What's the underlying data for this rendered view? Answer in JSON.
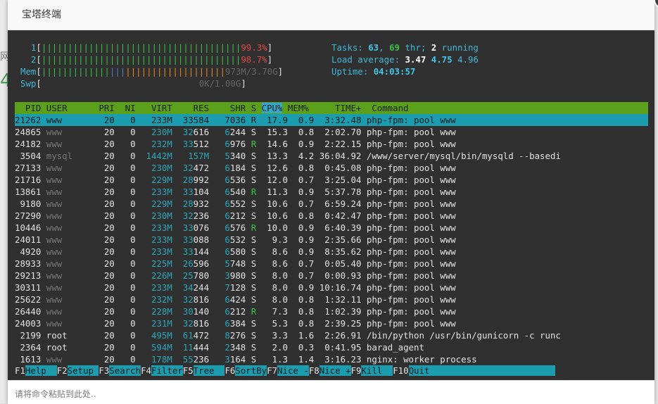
{
  "dialog": {
    "title": "宝塔终端",
    "input_placeholder": "请将命令粘贴到此处..",
    "backdrop_glyphs": [
      "网",
      "4"
    ]
  },
  "htop": {
    "meters": [
      {
        "label": "1",
        "bar": "||||||||||||||||||||||||||||||||||||||",
        "value": "99.3%"
      },
      {
        "label": "2",
        "bar": "||||||||||||||||||||||||||||||||||||||",
        "value": "98.7%"
      },
      {
        "label": "Mem",
        "bar_green": "|||||||||||||",
        "bar_blue": "|||",
        "bar_orange": "|||||||||||||||||||",
        "value": "973M/3.70G"
      },
      {
        "label": "Swp",
        "bar": "",
        "value": "0K/1.00G"
      }
    ],
    "tasks_label": "Tasks:",
    "tasks": "63",
    "thr": "69",
    "thr_label": "thr;",
    "running": "2",
    "running_label": "running",
    "load_label": "Load average:",
    "load1": "3.47",
    "load5": "4.75",
    "load15": "4.96",
    "uptime_label": "Uptime:",
    "uptime": "04:03:57",
    "columns": [
      "PID",
      "USER",
      "PRI",
      "NI",
      "VIRT",
      "RES",
      "SHR",
      "S",
      "CPU%",
      "MEM%",
      "TIME+",
      "Command"
    ],
    "processes": [
      {
        "pid": "21262",
        "user": "www",
        "pri": "20",
        "ni": "0",
        "virt": "233M",
        "res": "33584",
        "shr": "7036",
        "s": "R",
        "cpu": "17.9",
        "mem": "0.9",
        "time": "3:32.48",
        "cmd": "php-fpm: pool www"
      },
      {
        "pid": "24865",
        "user": "www",
        "pri": "20",
        "ni": "0",
        "virt": "230M",
        "res": "32616",
        "shr": "6244",
        "s": "S",
        "cpu": "15.3",
        "mem": "0.8",
        "time": "2:02.70",
        "cmd": "php-fpm: pool www"
      },
      {
        "pid": "24182",
        "user": "www",
        "pri": "20",
        "ni": "0",
        "virt": "232M",
        "res": "33512",
        "shr": "6976",
        "s": "R",
        "cpu": "14.6",
        "mem": "0.9",
        "time": "2:22.15",
        "cmd": "php-fpm: pool www"
      },
      {
        "pid": "3504",
        "user": "mysql",
        "pri": "20",
        "ni": "0",
        "virt": "1442M",
        "res": "157M",
        "shr": "5340",
        "s": "S",
        "cpu": "13.3",
        "mem": "4.2",
        "time": "36:04.92",
        "cmd": "/www/server/mysql/bin/mysqld --basedi"
      },
      {
        "pid": "27133",
        "user": "www",
        "pri": "20",
        "ni": "0",
        "virt": "230M",
        "res": "32472",
        "shr": "6184",
        "s": "S",
        "cpu": "12.6",
        "mem": "0.8",
        "time": "0:45.08",
        "cmd": "php-fpm: pool www"
      },
      {
        "pid": "21716",
        "user": "www",
        "pri": "20",
        "ni": "0",
        "virt": "229M",
        "res": "28992",
        "shr": "6536",
        "s": "S",
        "cpu": "12.0",
        "mem": "0.7",
        "time": "3:25.04",
        "cmd": "php-fpm: pool www"
      },
      {
        "pid": "13861",
        "user": "www",
        "pri": "20",
        "ni": "0",
        "virt": "233M",
        "res": "33104",
        "shr": "6540",
        "s": "R",
        "cpu": "11.3",
        "mem": "0.9",
        "time": "5:37.78",
        "cmd": "php-fpm: pool www"
      },
      {
        "pid": "9180",
        "user": "www",
        "pri": "20",
        "ni": "0",
        "virt": "229M",
        "res": "28932",
        "shr": "6552",
        "s": "S",
        "cpu": "10.6",
        "mem": "0.7",
        "time": "6:59.24",
        "cmd": "php-fpm: pool www"
      },
      {
        "pid": "27290",
        "user": "www",
        "pri": "20",
        "ni": "0",
        "virt": "230M",
        "res": "32236",
        "shr": "6212",
        "s": "S",
        "cpu": "10.6",
        "mem": "0.8",
        "time": "0:42.47",
        "cmd": "php-fpm: pool www"
      },
      {
        "pid": "10446",
        "user": "www",
        "pri": "20",
        "ni": "0",
        "virt": "233M",
        "res": "33076",
        "shr": "6576",
        "s": "R",
        "cpu": "10.0",
        "mem": "0.9",
        "time": "6:40.39",
        "cmd": "php-fpm: pool www"
      },
      {
        "pid": "24011",
        "user": "www",
        "pri": "20",
        "ni": "0",
        "virt": "233M",
        "res": "33088",
        "shr": "6532",
        "s": "S",
        "cpu": "9.3",
        "mem": "0.9",
        "time": "2:35.66",
        "cmd": "php-fpm: pool www"
      },
      {
        "pid": "4920",
        "user": "www",
        "pri": "20",
        "ni": "0",
        "virt": "233M",
        "res": "33144",
        "shr": "6580",
        "s": "S",
        "cpu": "8.6",
        "mem": "0.9",
        "time": "8:35.62",
        "cmd": "php-fpm: pool www"
      },
      {
        "pid": "28933",
        "user": "www",
        "pri": "20",
        "ni": "0",
        "virt": "225M",
        "res": "26596",
        "shr": "5748",
        "s": "S",
        "cpu": "8.6",
        "mem": "0.7",
        "time": "0:05.40",
        "cmd": "php-fpm: pool www"
      },
      {
        "pid": "29213",
        "user": "www",
        "pri": "20",
        "ni": "0",
        "virt": "226M",
        "res": "25780",
        "shr": "3980",
        "s": "S",
        "cpu": "8.0",
        "mem": "0.7",
        "time": "0:00.93",
        "cmd": "php-fpm: pool www"
      },
      {
        "pid": "30311",
        "user": "www",
        "pri": "20",
        "ni": "0",
        "virt": "233M",
        "res": "34244",
        "shr": "7128",
        "s": "S",
        "cpu": "8.0",
        "mem": "0.9",
        "time": "10:16.74",
        "cmd": "php-fpm: pool www"
      },
      {
        "pid": "25622",
        "user": "www",
        "pri": "20",
        "ni": "0",
        "virt": "232M",
        "res": "32816",
        "shr": "6424",
        "s": "S",
        "cpu": "8.0",
        "mem": "0.8",
        "time": "1:32.11",
        "cmd": "php-fpm: pool www"
      },
      {
        "pid": "26440",
        "user": "www",
        "pri": "20",
        "ni": "0",
        "virt": "228M",
        "res": "30140",
        "shr": "6212",
        "s": "R",
        "cpu": "7.3",
        "mem": "0.8",
        "time": "1:02.39",
        "cmd": "php-fpm: pool www"
      },
      {
        "pid": "24003",
        "user": "www",
        "pri": "20",
        "ni": "0",
        "virt": "231M",
        "res": "32816",
        "shr": "6384",
        "s": "S",
        "cpu": "5.3",
        "mem": "0.8",
        "time": "2:39.25",
        "cmd": "php-fpm: pool www"
      },
      {
        "pid": "2199",
        "user": "root",
        "pri": "20",
        "ni": "0",
        "virt": "495M",
        "res": "61472",
        "shr": "8276",
        "s": "S",
        "cpu": "3.3",
        "mem": "1.6",
        "time": "2:26.91",
        "cmd": "/bin/python /usr/bin/gunicorn -c runc"
      },
      {
        "pid": "2364",
        "user": "root",
        "pri": "20",
        "ni": "0",
        "virt": "594M",
        "res": "11444",
        "shr": "2348",
        "s": "S",
        "cpu": "2.0",
        "mem": "0.3",
        "time": "0:41.95",
        "cmd": "barad_agent"
      },
      {
        "pid": "1613",
        "user": "www",
        "pri": "20",
        "ni": "0",
        "virt": "178M",
        "res": "55236",
        "shr": "3164",
        "s": "S",
        "cpu": "1.3",
        "mem": "1.4",
        "time": "3:16.23",
        "cmd": "nginx: worker process"
      }
    ],
    "fkeys": [
      {
        "key": "F1",
        "label": "Help  "
      },
      {
        "key": "F2",
        "label": "Setup "
      },
      {
        "key": "F3",
        "label": "Search"
      },
      {
        "key": "F4",
        "label": "Filter"
      },
      {
        "key": "F5",
        "label": "Tree  "
      },
      {
        "key": "F6",
        "label": "SortBy"
      },
      {
        "key": "F7",
        "label": "Nice -"
      },
      {
        "key": "F8",
        "label": "Nice +"
      },
      {
        "key": "F9",
        "label": "Kill  "
      },
      {
        "key": "F10",
        "label": "Quit"
      }
    ]
  }
}
